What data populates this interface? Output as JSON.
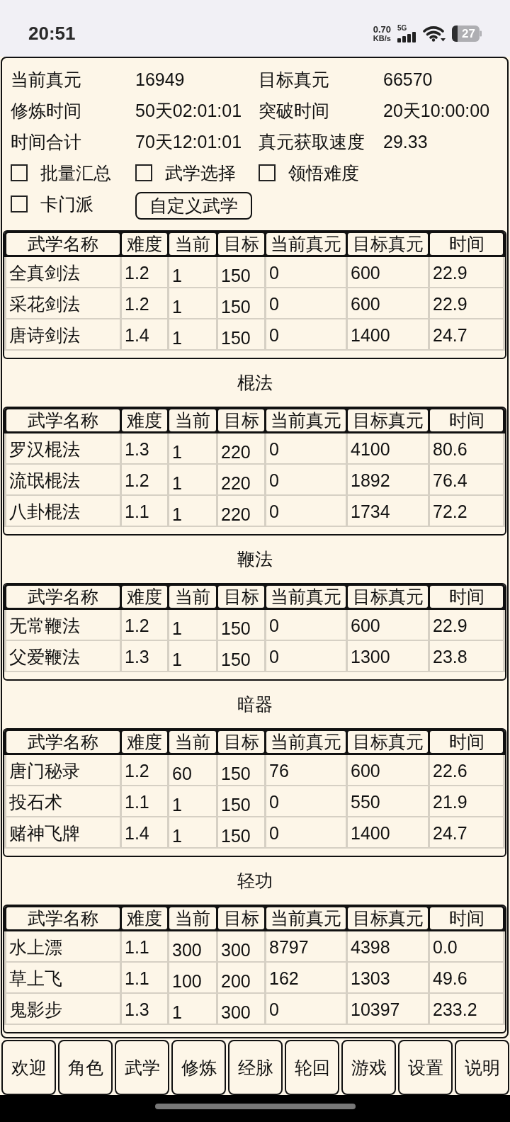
{
  "status_bar": {
    "time": "20:51",
    "net_speed": "0.70",
    "net_unit": "KB/s",
    "network_type": "5G",
    "battery": "27"
  },
  "summary": [
    {
      "label": "当前真元",
      "value": "16949"
    },
    {
      "label": "目标真元",
      "value": "66570"
    },
    {
      "label": "修炼时间",
      "value": "50天02:01:01"
    },
    {
      "label": "突破时间",
      "value": "20天10:00:00"
    },
    {
      "label": "时间合计",
      "value": "70天12:01:01"
    },
    {
      "label": "真元获取速度",
      "value": "29.33"
    }
  ],
  "options": [
    {
      "label": "批量汇总",
      "checked": false
    },
    {
      "label": "武学选择",
      "checked": false
    },
    {
      "label": "领悟难度",
      "checked": false
    },
    {
      "label": "卡门派",
      "checked": false
    }
  ],
  "custom_button": "自定义武学",
  "sections": [
    {
      "columns": [
        "武学名称",
        "难度",
        "当前",
        "目标",
        "当前真元",
        "目标真元",
        "时间"
      ],
      "rows": [
        [
          "全真剑法",
          "1.2",
          "1",
          "150",
          "0",
          "600",
          "22.9"
        ],
        [
          "采花剑法",
          "1.2",
          "1",
          "150",
          "0",
          "600",
          "22.9"
        ],
        [
          "唐诗剑法",
          "1.4",
          "1",
          "150",
          "0",
          "1400",
          "24.7"
        ]
      ]
    },
    {
      "title": "棍法",
      "columns": [
        "武学名称",
        "难度",
        "当前",
        "目标",
        "当前真元",
        "目标真元",
        "时间"
      ],
      "rows": [
        [
          "罗汉棍法",
          "1.3",
          "1",
          "220",
          "0",
          "4100",
          "80.6"
        ],
        [
          "流氓棍法",
          "1.2",
          "1",
          "220",
          "0",
          "1892",
          "76.4"
        ],
        [
          "八卦棍法",
          "1.1",
          "1",
          "220",
          "0",
          "1734",
          "72.2"
        ]
      ]
    },
    {
      "title": "鞭法",
      "columns": [
        "武学名称",
        "难度",
        "当前",
        "目标",
        "当前真元",
        "目标真元",
        "时间"
      ],
      "rows": [
        [
          "无常鞭法",
          "1.2",
          "1",
          "150",
          "0",
          "600",
          "22.9"
        ],
        [
          "父爱鞭法",
          "1.3",
          "1",
          "150",
          "0",
          "1300",
          "23.8"
        ]
      ]
    },
    {
      "title": "暗器",
      "columns": [
        "武学名称",
        "难度",
        "当前",
        "目标",
        "当前真元",
        "目标真元",
        "时间"
      ],
      "rows": [
        [
          "唐门秘录",
          "1.2",
          "60",
          "150",
          "76",
          "600",
          "22.6"
        ],
        [
          "投石术",
          "1.1",
          "1",
          "150",
          "0",
          "550",
          "21.9"
        ],
        [
          "赌神飞牌",
          "1.4",
          "1",
          "150",
          "0",
          "1400",
          "24.7"
        ]
      ]
    },
    {
      "title": "轻功",
      "columns": [
        "武学名称",
        "难度",
        "当前",
        "目标",
        "当前真元",
        "目标真元",
        "时间"
      ],
      "rows": [
        [
          "水上漂",
          "1.1",
          "300",
          "300",
          "8797",
          "4398",
          "0.0"
        ],
        [
          "草上飞",
          "1.1",
          "100",
          "200",
          "162",
          "1303",
          "49.6"
        ],
        [
          "鬼影步",
          "1.3",
          "1",
          "300",
          "0",
          "10397",
          "233.2"
        ]
      ]
    }
  ],
  "nav": [
    "欢迎",
    "角色",
    "武学",
    "修炼",
    "经脉",
    "轮回",
    "游戏",
    "设置",
    "说明"
  ]
}
